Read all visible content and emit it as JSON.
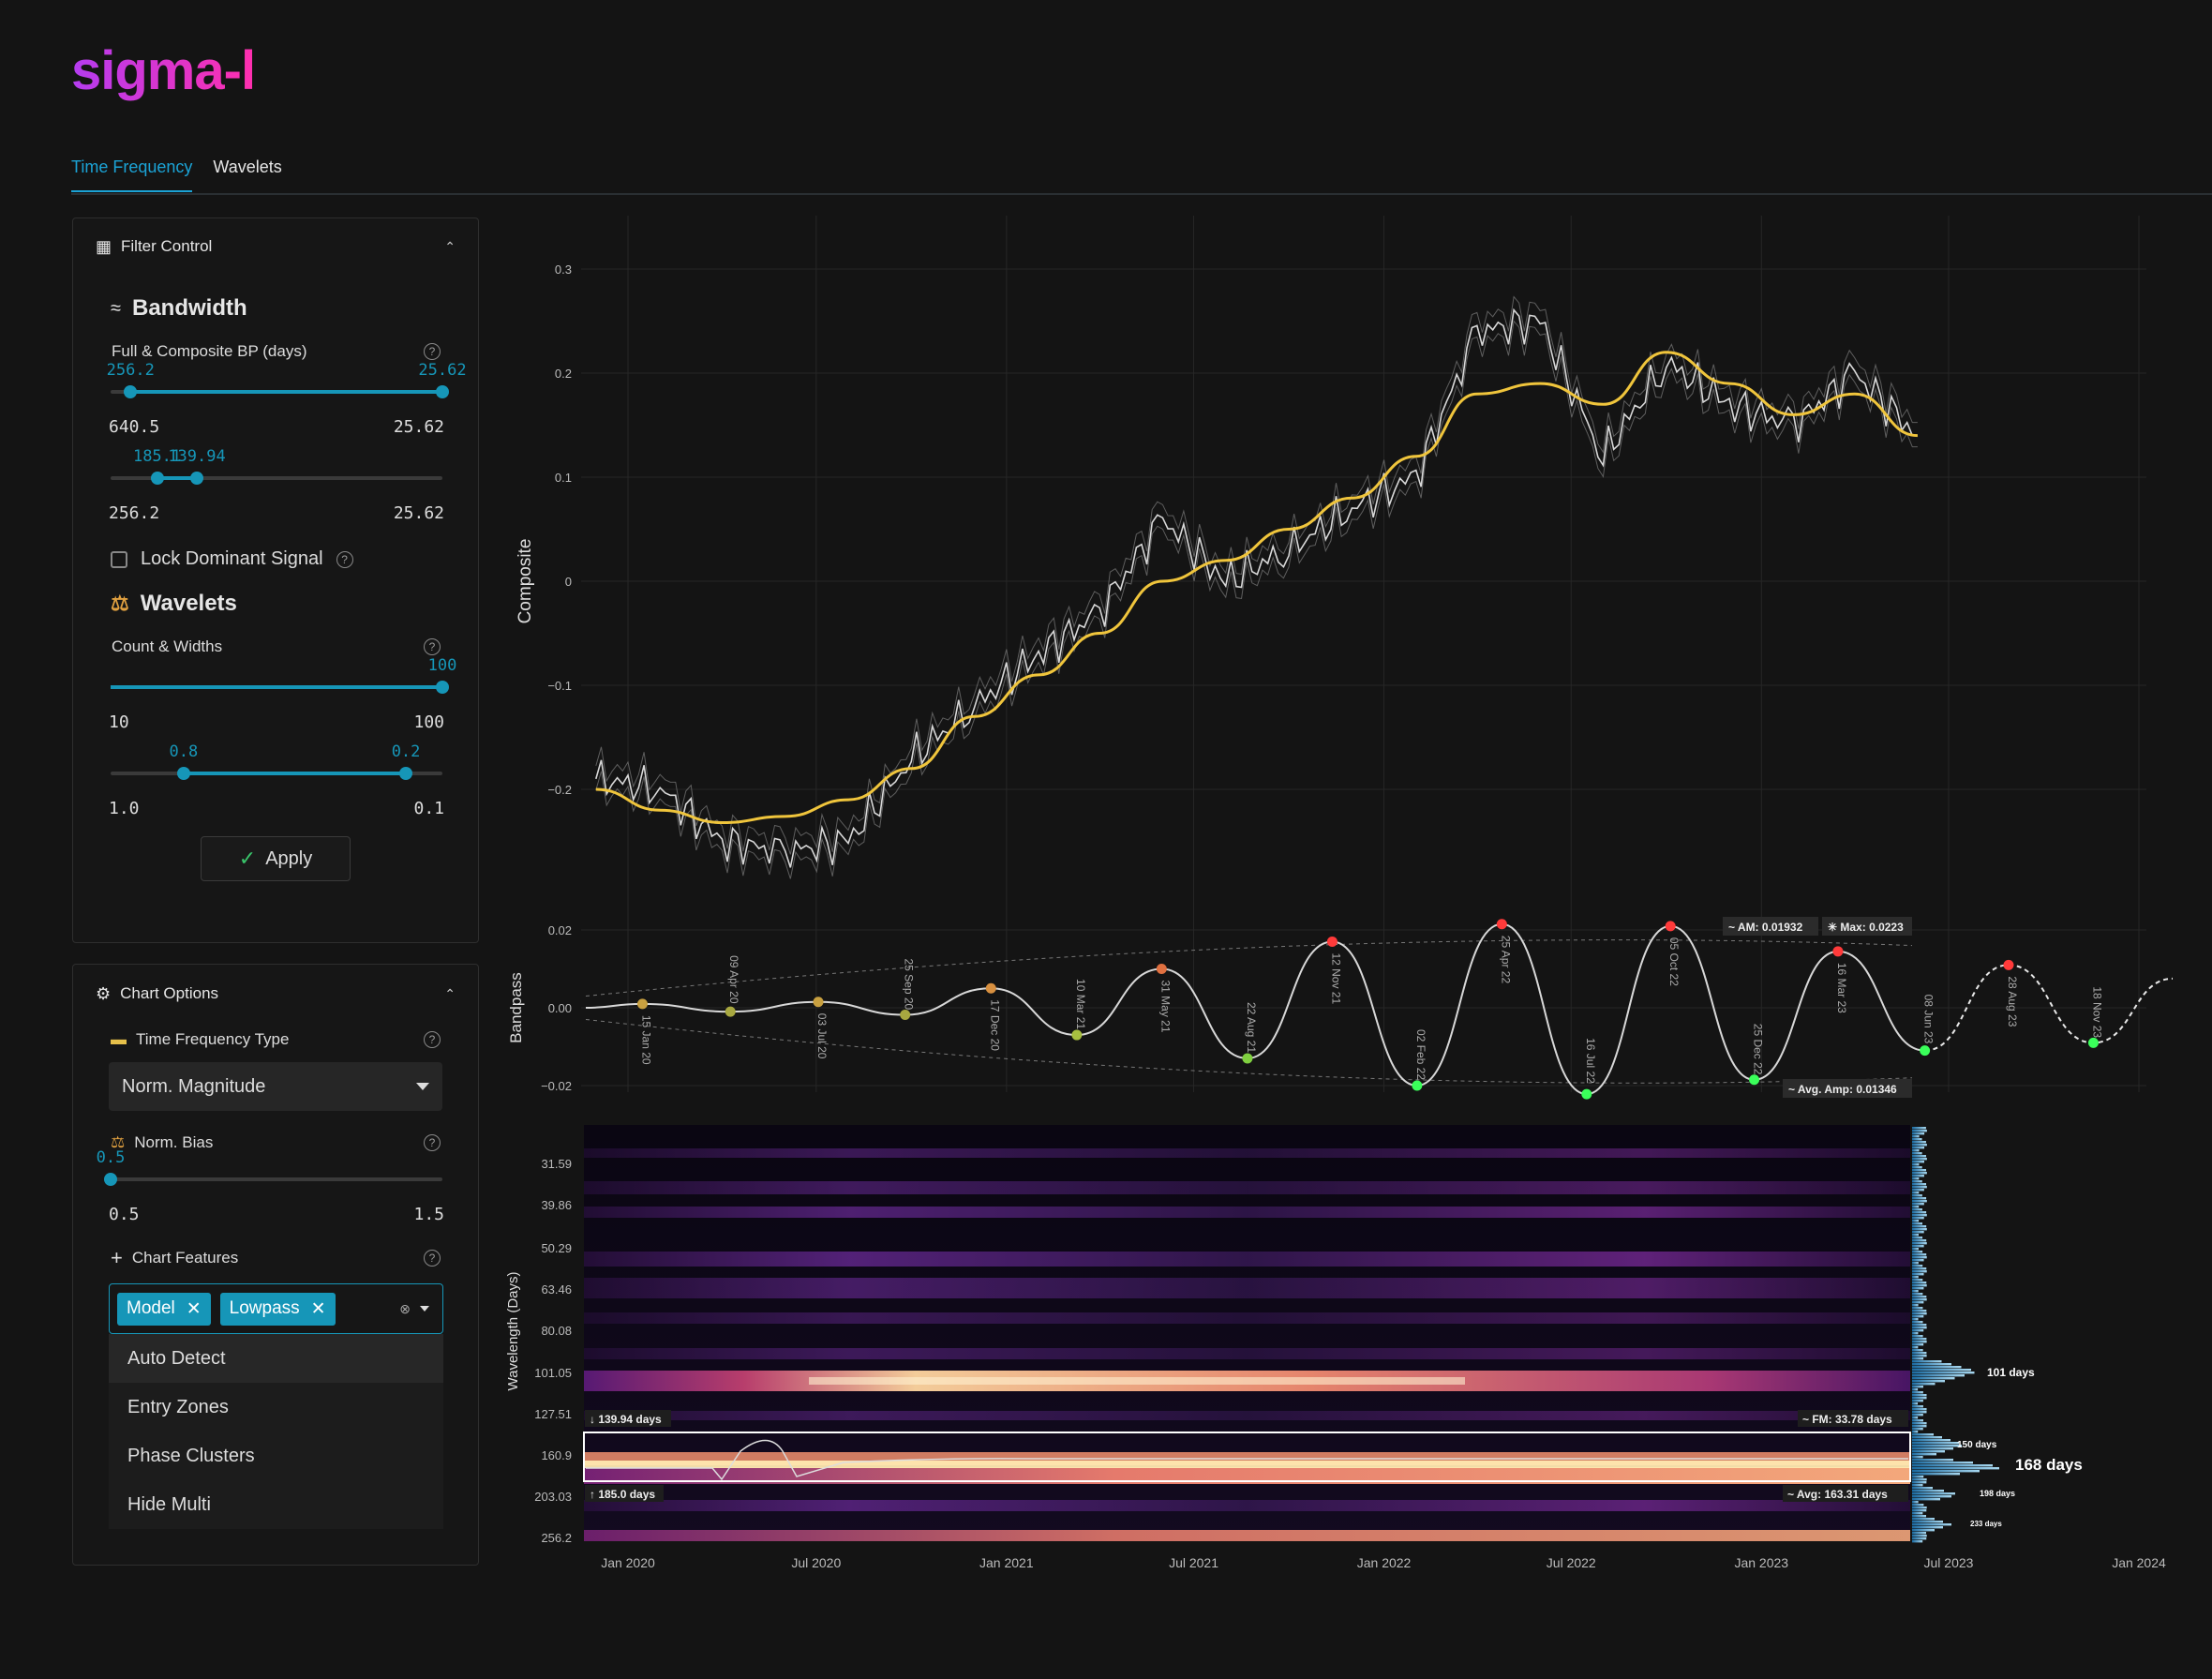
{
  "app": {
    "logo": "sigma-l"
  },
  "tabs": [
    {
      "label": "Time Frequency",
      "active": true
    },
    {
      "label": "Wavelets",
      "active": false
    }
  ],
  "filter_control": {
    "title": "Filter Control",
    "bandwidth_title": "Bandwidth",
    "bp_label": "Full & Composite BP (days)",
    "full_slider": {
      "low": "256.2",
      "high": "25.62",
      "min": "640.5",
      "max": "25.62",
      "low_frac": 0.06,
      "high_frac": 1.0
    },
    "comp_slider": {
      "low": "185.1",
      "high": "139.94",
      "min": "256.2",
      "max": "25.62",
      "low_frac": 0.14,
      "high_frac": 0.26
    },
    "lock_label": "Lock Dominant Signal",
    "wavelets_title": "Wavelets",
    "count_label": "Count & Widths",
    "count_slider": {
      "value": "100",
      "min": "10",
      "max": "100",
      "frac": 1.0
    },
    "width_slider": {
      "low": "0.8",
      "high": "0.2",
      "min": "1.0",
      "max": "0.1",
      "low_frac": 0.22,
      "high_frac": 0.89
    },
    "apply_label": "Apply"
  },
  "chart_options": {
    "title": "Chart Options",
    "tf_type_label": "Time Frequency Type",
    "tf_type_value": "Norm. Magnitude",
    "bias_label": "Norm. Bias",
    "bias_slider": {
      "value": "0.5",
      "min": "0.5",
      "max": "1.5",
      "frac": 0.0
    },
    "features_label": "Chart Features",
    "chips": [
      "Model",
      "Lowpass"
    ],
    "dropdown": [
      "Auto Detect",
      "Entry Zones",
      "Phase Clusters",
      "Hide Multi"
    ]
  },
  "chart_data": [
    {
      "type": "line",
      "ylabel": "Composite",
      "yticks": [
        "0.3",
        "0.2",
        "0.1",
        "0",
        "−0.1",
        "−0.2"
      ],
      "ylim": [
        -0.27,
        0.32
      ],
      "x": [
        "2019-12-01",
        "2020-02-01",
        "2020-04-01",
        "2020-06-01",
        "2020-08-01",
        "2020-10-01",
        "2020-12-01",
        "2021-02-01",
        "2021-04-01",
        "2021-06-01",
        "2021-08-01",
        "2021-10-01",
        "2021-12-01",
        "2022-02-01",
        "2022-04-01",
        "2022-06-01",
        "2022-08-01",
        "2022-10-01",
        "2022-12-01",
        "2023-02-01",
        "2023-04-01",
        "2023-06-01"
      ],
      "series": [
        {
          "color": "#f0c53c",
          "values": [
            -0.2,
            -0.22,
            -0.232,
            -0.226,
            -0.21,
            -0.18,
            -0.13,
            -0.09,
            -0.05,
            0.0,
            0.02,
            0.05,
            0.08,
            0.12,
            0.18,
            0.19,
            0.17,
            0.22,
            0.19,
            0.16,
            0.18,
            0.14
          ]
        },
        {
          "color": "#d8d8d8",
          "values": [
            -0.19,
            -0.2,
            -0.25,
            -0.26,
            -0.25,
            -0.17,
            -0.12,
            -0.07,
            -0.03,
            0.06,
            0.0,
            0.03,
            0.07,
            0.1,
            0.24,
            0.25,
            0.12,
            0.21,
            0.17,
            0.15,
            0.2,
            0.14
          ]
        }
      ]
    },
    {
      "type": "line",
      "ylabel": "Bandpass",
      "yticks": [
        "0.02",
        "0.00",
        "−0.02"
      ],
      "ylim": [
        -0.025,
        0.025
      ],
      "markers": [
        {
          "label": "15 Jan 20",
          "date": "2020-01-15",
          "value": 0.001
        },
        {
          "label": "09 Apr 20",
          "date": "2020-04-09",
          "value": -0.001
        },
        {
          "label": "03 Jul 20",
          "date": "2020-07-03",
          "value": 0.0015
        },
        {
          "label": "25 Sep 20",
          "date": "2020-09-25",
          "value": -0.0018
        },
        {
          "label": "17 Dec 20",
          "date": "2020-12-17",
          "value": 0.005
        },
        {
          "label": "10 Mar 21",
          "date": "2021-03-10",
          "value": -0.007
        },
        {
          "label": "31 May 21",
          "date": "2021-05-31",
          "value": 0.01
        },
        {
          "label": "22 Aug 21",
          "date": "2021-08-22",
          "value": -0.013
        },
        {
          "label": "12 Nov 21",
          "date": "2021-11-12",
          "value": 0.017
        },
        {
          "label": "02 Feb 22",
          "date": "2022-02-02",
          "value": -0.02
        },
        {
          "label": "25 Apr 22",
          "date": "2022-04-25",
          "value": 0.0215
        },
        {
          "label": "16 Jul 22",
          "date": "2022-07-16",
          "value": -0.0222
        },
        {
          "label": "05 Oct 22",
          "date": "2022-10-05",
          "value": 0.021
        },
        {
          "label": "25 Dec 22",
          "date": "2022-12-25",
          "value": -0.0185
        },
        {
          "label": "16 Mar 23",
          "date": "2023-03-16",
          "value": 0.0145
        },
        {
          "label": "08 Jun 23",
          "date": "2023-06-08",
          "value": -0.011
        },
        {
          "label": "28 Aug 23",
          "date": "2023-08-28",
          "value": 0.011
        },
        {
          "label": "18 Nov 23",
          "date": "2023-11-18",
          "value": -0.009
        }
      ],
      "annotations": [
        "AM: 0.01932",
        "Max: 0.0223",
        "Avg. Amp: 0.01346"
      ]
    },
    {
      "type": "heatmap",
      "ylabel": "Wavelength (Days)",
      "yticks": [
        "31.59",
        "39.86",
        "50.29",
        "63.46",
        "80.08",
        "101.05",
        "127.51",
        "160.9",
        "203.03",
        "256.2"
      ],
      "xticks": [
        "Jan 2020",
        "Jul 2020",
        "Jan 2021",
        "Jul 2021",
        "Jan 2022",
        "Jul 2022",
        "Jan 2023",
        "Jul 2023",
        "Jan 2024"
      ],
      "band_labels": [
        "139.94 days",
        "185.0 days",
        "FM: 33.78 days",
        "Avg: 163.31 days"
      ],
      "spectrum_peaks": [
        "101 days",
        "150 days",
        "168 days",
        "198 days",
        "233 days"
      ]
    }
  ]
}
